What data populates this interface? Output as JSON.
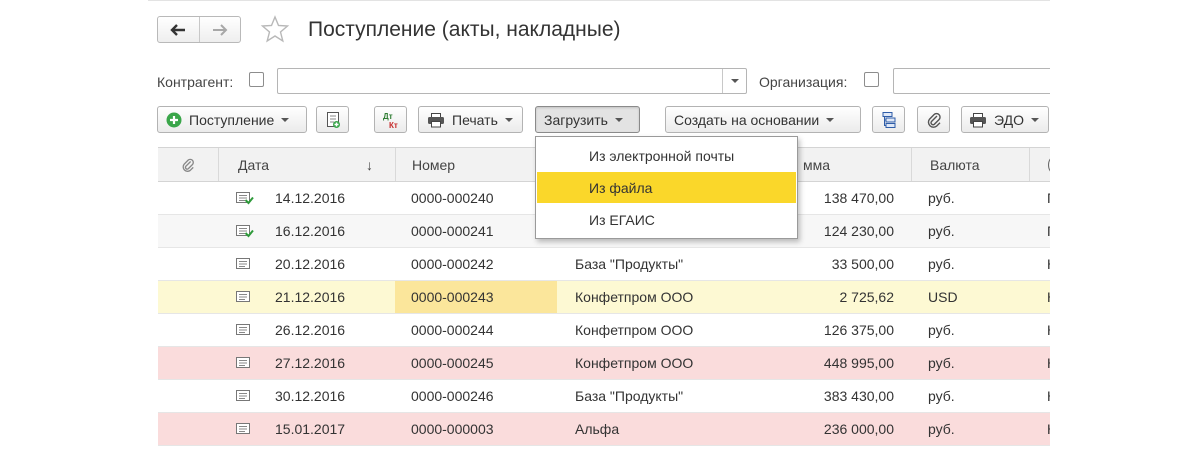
{
  "title": "Поступление (акты, накладные)",
  "filters": {
    "counterparty_label": "Контрагент:",
    "organization_label": "Организация:",
    "counterparty_value": "",
    "organization_value": ""
  },
  "toolbar": {
    "receipt_label": "Поступление",
    "print_label": "Печать",
    "load_label": "Загрузить",
    "create_based_label": "Создать на основании",
    "edo_label": "ЭДО",
    "dtkt_top": "Дт",
    "dtkt_bottom": "Кт"
  },
  "table": {
    "columns": {
      "date": "Дата",
      "number": "Номер",
      "sum": "мма",
      "currency": "Валюта"
    },
    "sort_indicator": "↓",
    "rows": [
      {
        "date": "14.12.2016",
        "number": "0000-000240",
        "counterparty": "",
        "sum": "138 470,00",
        "currency": "руб.",
        "extra": "Г",
        "icon": "posted-doc-icon",
        "style": "normal"
      },
      {
        "date": "16.12.2016",
        "number": "0000-000241",
        "counterparty": "",
        "sum": "124 230,00",
        "currency": "руб.",
        "extra": "Г",
        "icon": "posted-doc-icon",
        "style": "alt"
      },
      {
        "date": "20.12.2016",
        "number": "0000-000242",
        "counterparty": "База \"Продукты\"",
        "sum": "33 500,00",
        "currency": "руб.",
        "extra": "К",
        "icon": "doc-icon",
        "style": "normal"
      },
      {
        "date": "21.12.2016",
        "number": "0000-000243",
        "counterparty": "Конфетпром ООО",
        "sum": "2 725,62",
        "currency": "USD",
        "extra": "К",
        "icon": "doc-icon",
        "style": "selected"
      },
      {
        "date": "26.12.2016",
        "number": "0000-000244",
        "counterparty": "Конфетпром ООО",
        "sum": "126 375,00",
        "currency": "руб.",
        "extra": "К",
        "icon": "doc-icon",
        "style": "normal"
      },
      {
        "date": "27.12.2016",
        "number": "0000-000245",
        "counterparty": "Конфетпром ООО",
        "sum": "448 995,00",
        "currency": "руб.",
        "extra": "К",
        "icon": "doc-icon",
        "style": "pink"
      },
      {
        "date": "30.12.2016",
        "number": "0000-000246",
        "counterparty": "База \"Продукты\"",
        "sum": "383 430,00",
        "currency": "руб.",
        "extra": "К",
        "icon": "doc-icon",
        "style": "normal"
      },
      {
        "date": "15.01.2017",
        "number": "0000-000003",
        "counterparty": "Альфа",
        "sum": "236 000,00",
        "currency": "руб.",
        "extra": "К",
        "icon": "doc-icon",
        "style": "pink"
      }
    ]
  },
  "load_menu": {
    "items": [
      {
        "label": "Из электронной почты",
        "selected": false
      },
      {
        "label": "Из файла",
        "selected": true
      },
      {
        "label": "Из ЕГАИС",
        "selected": false
      }
    ]
  },
  "colors": {
    "row_alt": "#f7f7f7",
    "row_selected": "#fdf9d3",
    "row_pink": "#fadcdc",
    "current_cell": "#fbe69b",
    "menu_selected": "#fad72a",
    "green_add": "#3aa64a"
  }
}
